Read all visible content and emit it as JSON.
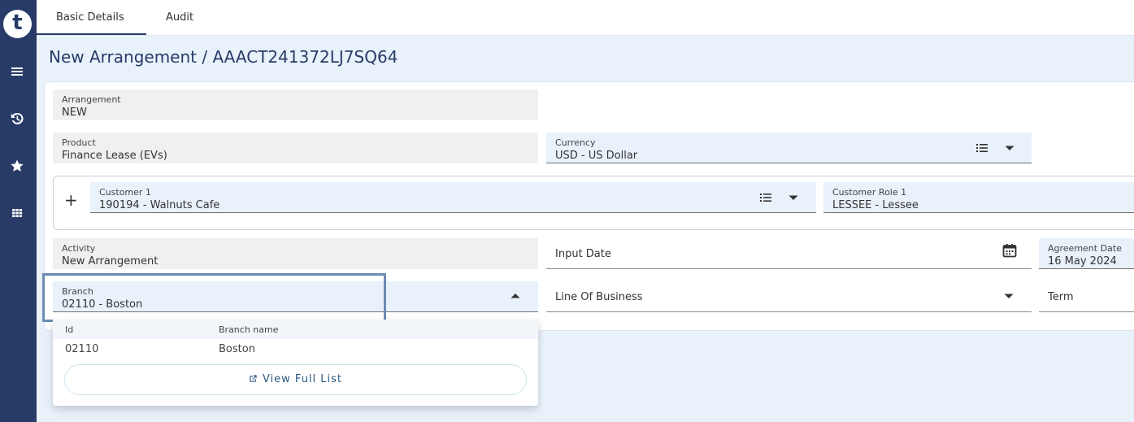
{
  "logo": {
    "letter": "t"
  },
  "sidebar": {
    "items": [
      {
        "icon": "menu-icon"
      },
      {
        "icon": "history-icon"
      },
      {
        "icon": "star-icon"
      },
      {
        "icon": "apps-grid-icon"
      }
    ]
  },
  "tabs": [
    {
      "label": "Basic Details",
      "active": true
    },
    {
      "label": "Audit",
      "active": false
    }
  ],
  "page": {
    "title": "New Arrangement / AAACT241372LJ7SQ64"
  },
  "fields": {
    "arrangement": {
      "label": "Arrangement",
      "value": "NEW"
    },
    "product": {
      "label": "Product",
      "value": "Finance Lease (EVs)"
    },
    "currency": {
      "label": "Currency",
      "value": "USD - US Dollar"
    },
    "customer1": {
      "label": "Customer 1",
      "value": "190194 - Walnuts Cafe"
    },
    "customer_role1": {
      "label": "Customer Role 1",
      "value": "LESSEE - Lessee"
    },
    "activity": {
      "label": "Activity",
      "value": "New Arrangement"
    },
    "input_date": {
      "placeholder": "Input Date"
    },
    "agreement_date": {
      "label": "Agreement Date",
      "value": "16 May 2024"
    },
    "branch": {
      "label": "Branch",
      "value": "02110 - Boston"
    },
    "line_of_business": {
      "placeholder": "Line Of Business"
    },
    "term": {
      "placeholder": "Term"
    }
  },
  "customer": {
    "add_symbol": "+"
  },
  "branch_dropdown": {
    "columns": [
      "Id",
      "Branch name"
    ],
    "rows": [
      {
        "id": "02110",
        "name": "Boston"
      }
    ],
    "view_full_list": "View Full List"
  },
  "colors": {
    "sidebar": "#283b67",
    "accent": "#283b67",
    "field_fill": "#e9f1fb",
    "highlight": "#6c8cb4"
  }
}
